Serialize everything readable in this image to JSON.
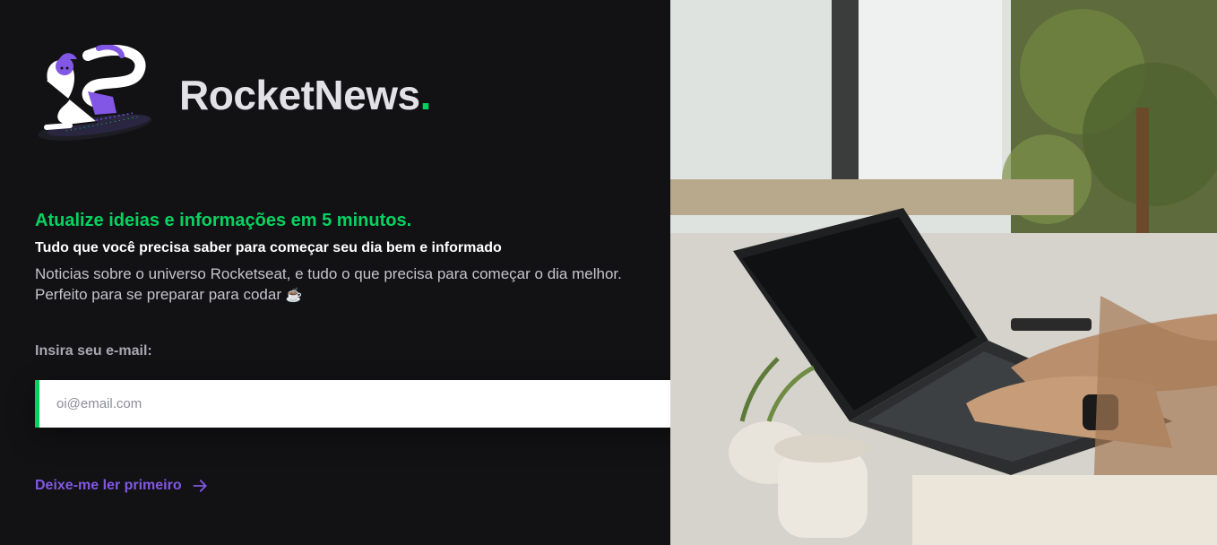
{
  "brand": {
    "name": "RocketNews",
    "dot": "."
  },
  "hero": {
    "headline": "Atualize ideias e informações em 5 minutos.",
    "subheadline": "Tudo que você precisa saber para começar seu dia bem e informado",
    "description": "Noticias sobre o universo Rocketseat, e tudo o que precisa para começar o dia melhor. Perfeito para se preparar para codar",
    "description_emoji": "☕"
  },
  "form": {
    "label": "Insira seu e-mail:",
    "placeholder": "oi@email.com",
    "submit_icon": "send-icon"
  },
  "link": {
    "label": "Deixe-me ler primeiro",
    "icon": "arrow-right-icon"
  },
  "colors": {
    "background": "#121214",
    "accent_green": "#04d361",
    "accent_purple": "#8257e5",
    "text_light": "#e1e1e6",
    "text_muted": "#a8a8b3"
  }
}
